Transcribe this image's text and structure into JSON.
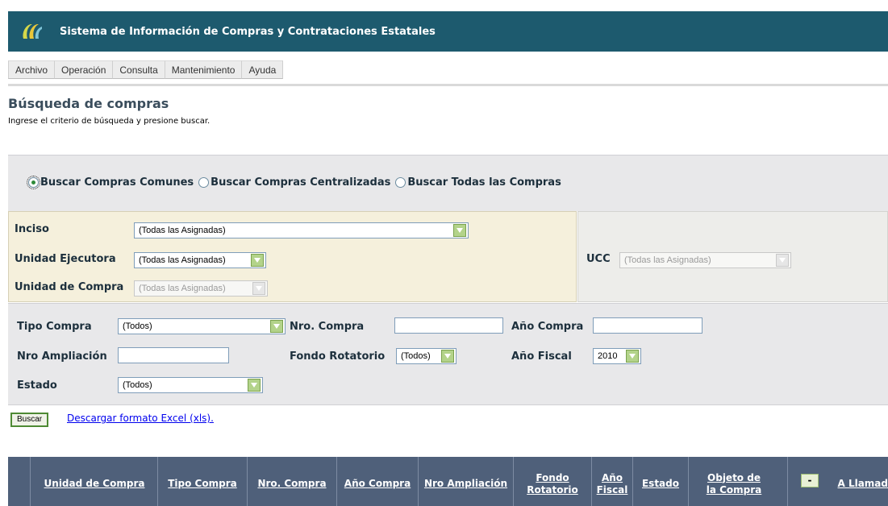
{
  "app": {
    "title": "Sistema de Información de Compras y Contrataciones Estatales",
    "colors": {
      "header_bg": "#1d5a6e",
      "accent_green": "#4e8a34",
      "table_header_bg": "#4f607a"
    }
  },
  "menu": {
    "items": [
      {
        "label": "Archivo"
      },
      {
        "label": "Operación"
      },
      {
        "label": "Consulta"
      },
      {
        "label": "Mantenimiento"
      },
      {
        "label": "Ayuda"
      }
    ]
  },
  "page": {
    "title": "Búsqueda de compras",
    "subtitle": "Ingrese el criterio de búsqueda y presione buscar."
  },
  "search_mode": {
    "options": [
      {
        "label": "Buscar Compras Comunes",
        "checked": true
      },
      {
        "label": "Buscar Compras Centralizadas",
        "checked": false
      },
      {
        "label": "Buscar Todas las Compras",
        "checked": false
      }
    ]
  },
  "org": {
    "inciso": {
      "label": "Inciso",
      "value": "(Todas las Asignadas)"
    },
    "unidad_ejecutora": {
      "label": "Unidad Ejecutora",
      "value": "(Todas las Asignadas)"
    },
    "unidad_compra": {
      "label": "Unidad de Compra",
      "value": "(Todas las Asignadas)",
      "disabled": true
    },
    "ucc": {
      "label": "UCC",
      "value": "(Todas las Asignadas)",
      "disabled": true
    }
  },
  "filters": {
    "tipo_compra": {
      "label": "Tipo Compra",
      "value": "(Todos)"
    },
    "nro_compra": {
      "label": "Nro. Compra",
      "value": ""
    },
    "anio_compra": {
      "label": "Año Compra",
      "value": ""
    },
    "nro_ampliacion": {
      "label": "Nro Ampliación",
      "value": ""
    },
    "fondo_rotatorio": {
      "label": "Fondo Rotatorio",
      "value": "(Todos)"
    },
    "anio_fiscal": {
      "label": "Año Fiscal",
      "value": "2010"
    },
    "estado": {
      "label": "Estado",
      "value": "(Todos)"
    }
  },
  "actions": {
    "buscar_label": "Buscar",
    "excel_link": "Descargar formato Excel (xls)."
  },
  "results": {
    "columns": [
      {
        "label": "Unidad de Compra"
      },
      {
        "label": "Tipo Compra"
      },
      {
        "label": "Nro. Compra"
      },
      {
        "label": "Año Compra"
      },
      {
        "label": "Nro Ampliación"
      },
      {
        "label": "Fondo Rotatorio"
      },
      {
        "label": "Año Fiscal"
      },
      {
        "label": "Estado"
      },
      {
        "label": "Objeto de la Compra"
      },
      {
        "label": "A Llamad"
      }
    ],
    "collapse_button": "-"
  }
}
